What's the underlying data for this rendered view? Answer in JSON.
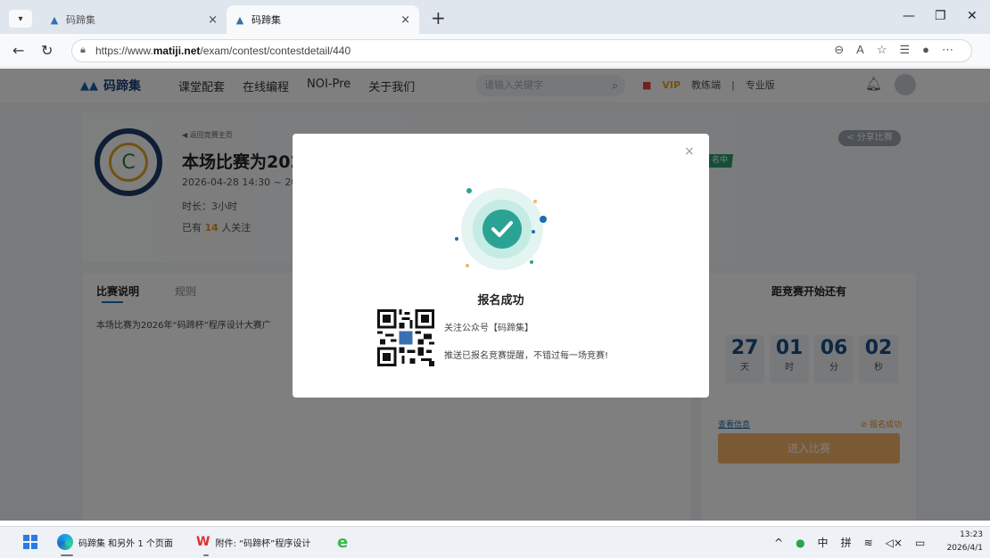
{
  "browser": {
    "tabs": [
      {
        "label": "码蹄集",
        "active": false
      },
      {
        "label": "码蹄集",
        "active": true
      }
    ],
    "tab_menu_label": "▾",
    "new_tab_label": "+",
    "url_prefix": "https://www.",
    "url_domain": "matiji.net",
    "url_path": "/exam/contest/contestdetail/440"
  },
  "site": {
    "logo": "码蹄集",
    "nav": [
      "课堂配套",
      "在线编程",
      "NOI-Pre",
      "关于我们"
    ],
    "search_placeholder": "请输入关键字",
    "vip": "VIP",
    "coach": "教练端",
    "pro": "专业版"
  },
  "contest": {
    "back_link": "◀ 返回竞赛主页",
    "title": "本场比赛为202",
    "time": "2026-04-28 14:30 ~ 20",
    "duration": "时长：3小时",
    "follow_prefix": "已有",
    "follow_count": "14",
    "follow_suffix": "人关注",
    "badge": "名中",
    "share": "< 分享比赛"
  },
  "description": {
    "tab_desc": "比赛说明",
    "tab_rules": "规则",
    "text": "本场比赛为2026年“码蹄杯”程序设计大赛广"
  },
  "countdown": {
    "title": "距竞赛开始还有",
    "days": "27",
    "days_unit": "天",
    "hours": "01",
    "hours_unit": "时",
    "minutes": "06",
    "minutes_unit": "分",
    "seconds": "02",
    "seconds_unit": "秒",
    "view_info": "查看信息",
    "status": "⊘ 报名成功",
    "enter_button": "进入比赛"
  },
  "modal": {
    "close": "×",
    "title": "报名成功",
    "line1": "关注公众号【码蹄集】",
    "line2": "推送已报名竞赛提醒，不错过每一场竞赛!"
  },
  "taskbar": {
    "edge_label": "码蹄集 和另外 1 个页面",
    "wps_label": "附件: “码蹄杯”程序设计",
    "tray_ime1": "中",
    "tray_ime2": "拼",
    "time": "13:23",
    "date": "2026/4/1"
  },
  "colors": {
    "accent": "#1a6fb0",
    "success": "#2aa394",
    "vip": "#e8a21c",
    "enter_button": "#f4b56a"
  }
}
